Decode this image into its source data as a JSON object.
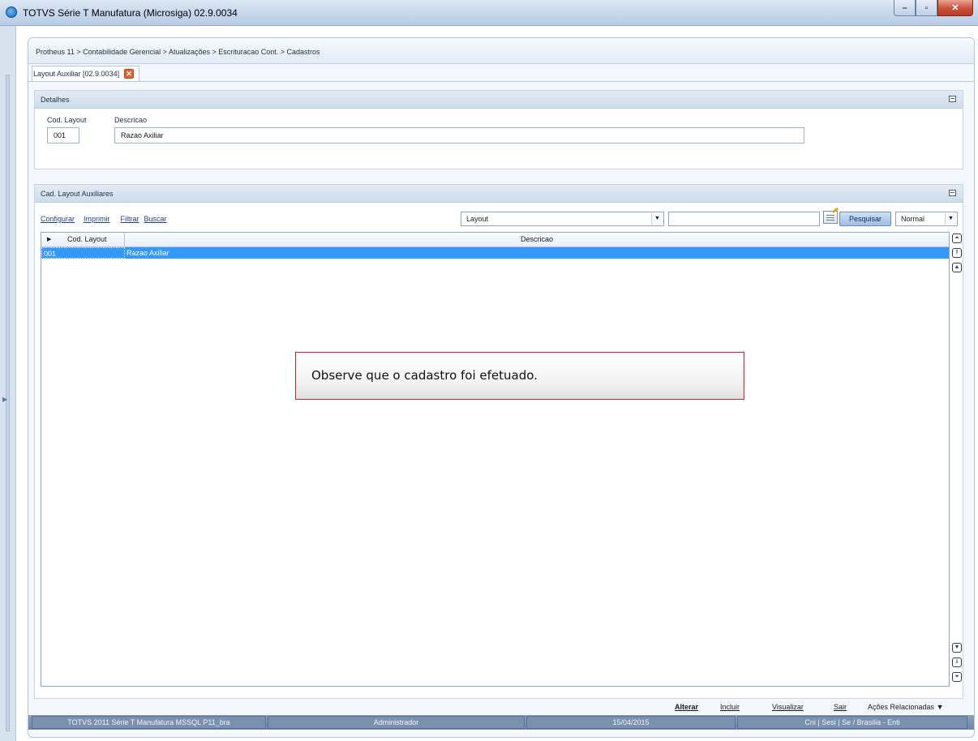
{
  "window": {
    "title": "TOTVS Série T Manufatura (Microsiga) 02.9.0034"
  },
  "breadcrumb": "Protheus 11 > Contabilidade Gerencial > Atualizações > Escrituracao Cont. > Cadastros",
  "tab": {
    "label": "Layout Auxiliar [02.9.0034]"
  },
  "details": {
    "title": "Detalhes",
    "cod_label": "Cod. Layout",
    "cod_value": "001",
    "desc_label": "Descricao",
    "desc_value": "Razao Axiliar"
  },
  "grid_panel": {
    "title": "Cad. Layout Auxiliares",
    "links": [
      "Configurar",
      "Imprimir",
      "Filtrar",
      "Buscar"
    ],
    "index_select": "Layout",
    "search_value": "",
    "search_button": "Pesquisar",
    "mode_select": "Normal",
    "columns": [
      "Cod. Layout",
      "Descricao"
    ],
    "rows": [
      {
        "cod": "001",
        "descricao": "Razao Axiliar"
      }
    ]
  },
  "callout": "Observe que o cadastro foi efetuado.",
  "actions": {
    "alterar": "Alterar",
    "incluir": "Incluir",
    "visualizar": "Visualizar",
    "sair": "Sair",
    "acoes": "Ações Relacionadas"
  },
  "statusbar": {
    "system": "TOTVS 2011 Série T Manufatura MSSQL P11_bra",
    "user": "Administrador",
    "date": "15/04/2015",
    "company": "Cni | Sesi | Se / Brasilia - Enti"
  },
  "colors": {
    "selection": "#3399ff",
    "callout_border": "#d42020",
    "close_tab": "#e8622a"
  }
}
